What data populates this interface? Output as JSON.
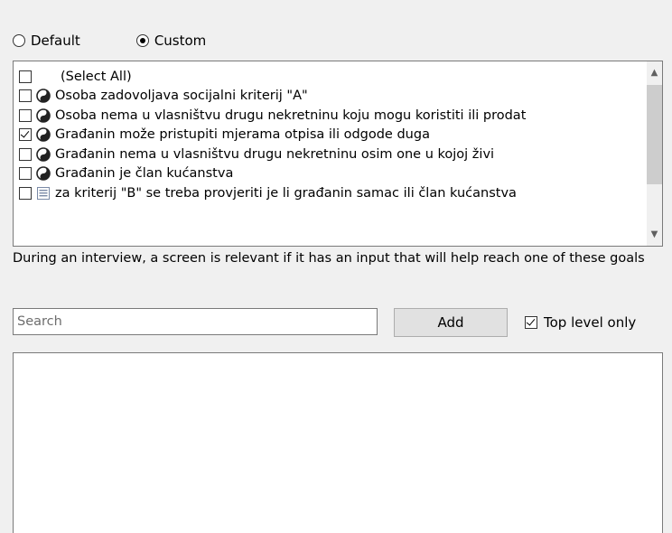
{
  "mode": {
    "default_label": "Default",
    "custom_label": "Custom",
    "selected": "custom"
  },
  "goals": {
    "select_all_label": "(Select All)",
    "items": [
      {
        "label": "Osoba zadovoljava socijalni kriterij \"A\"",
        "checked": false,
        "icon": "goal-icon"
      },
      {
        "label": "Osoba nema u vlasništvu drugu nekretninu koju mogu koristiti ili prodat",
        "checked": false,
        "icon": "goal-icon"
      },
      {
        "label": "Građanin može pristupiti mjerama otpisa ili odgode duga",
        "checked": true,
        "icon": "goal-icon"
      },
      {
        "label": "Građanin nema u vlasništvu drugu nekretninu osim one u kojoj živi",
        "checked": false,
        "icon": "goal-icon"
      },
      {
        "label": "Građanin je član kućanstva",
        "checked": false,
        "icon": "goal-icon"
      },
      {
        "label": "za kriterij \"B\" se treba provjeriti je li građanin samac ili član kućanstva",
        "checked": false,
        "icon": "note-icon"
      }
    ]
  },
  "description": "During an interview, a screen is relevant if it has an input that will help reach one of these goals",
  "search": {
    "placeholder": "Search",
    "value": ""
  },
  "add_button_label": "Add",
  "top_level_only": {
    "label": "Top level only",
    "checked": true
  }
}
